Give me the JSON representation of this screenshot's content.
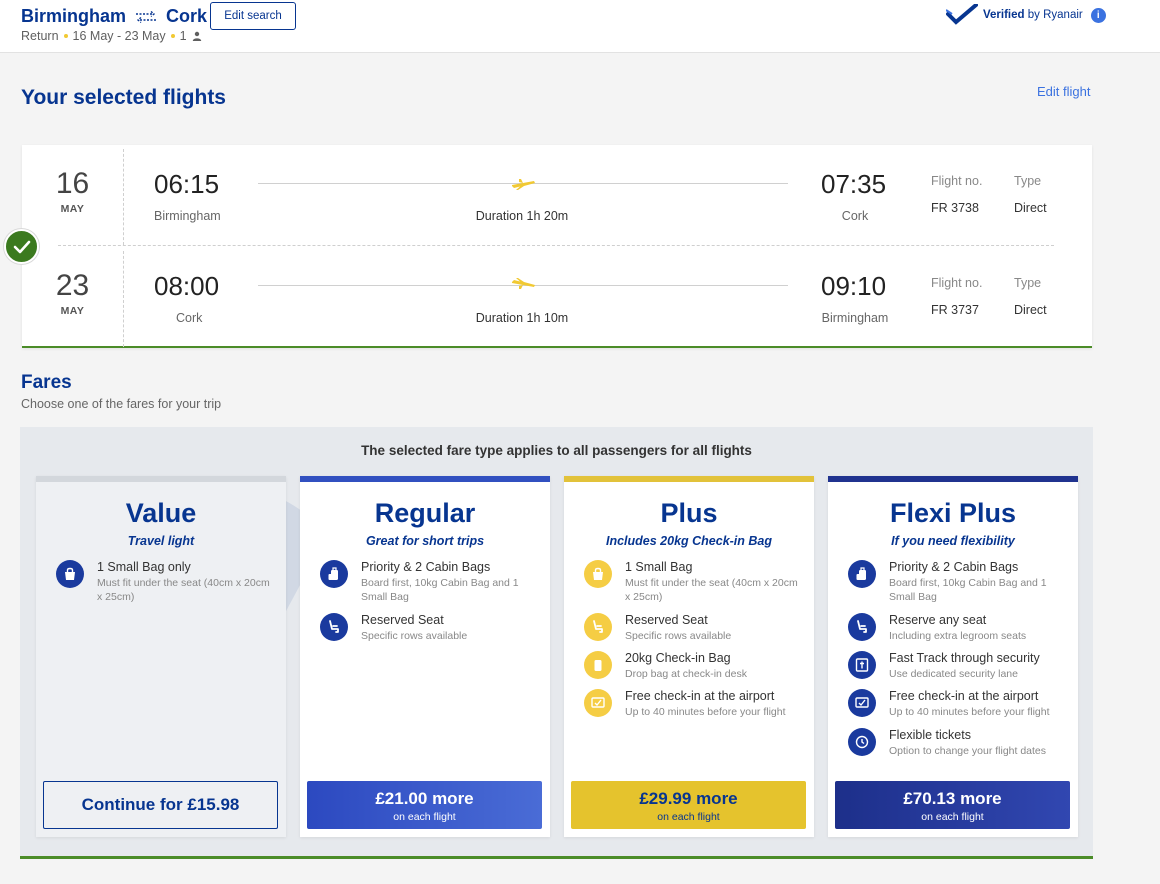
{
  "header": {
    "origin": "Birmingham",
    "destination": "Cork",
    "trip_type": "Return",
    "dates": "16 May - 23 May",
    "passengers": "1",
    "edit_search_label": "Edit search",
    "verified_bold": "Verified",
    "verified_rest": "by Ryanair"
  },
  "selected": {
    "title": "Your selected flights",
    "edit_label": "Edit flight"
  },
  "flights": [
    {
      "day": "16",
      "month": "MAY",
      "dep_time": "06:15",
      "dep_city": "Birmingham",
      "arr_time": "07:35",
      "arr_city": "Cork",
      "duration": "Duration 1h 20m",
      "flight_no_label": "Flight no.",
      "flight_no": "FR 3738",
      "type_label": "Type",
      "type": "Direct"
    },
    {
      "day": "23",
      "month": "MAY",
      "dep_time": "08:00",
      "dep_city": "Cork",
      "arr_time": "09:10",
      "arr_city": "Birmingham",
      "duration": "Duration 1h 10m",
      "flight_no_label": "Flight no.",
      "flight_no": "FR 3737",
      "type_label": "Type",
      "type": "Direct"
    }
  ],
  "fares": {
    "title": "Fares",
    "subtitle": "Choose one of the fares for your trip",
    "note": "The selected fare type applies to all passengers for all flights",
    "cards": [
      {
        "name": "Value",
        "tag": "Travel light",
        "features": [
          {
            "title": "1 Small Bag only",
            "desc": "Must fit under the seat (40cm x 20cm x 25cm)"
          }
        ],
        "button": {
          "label": "Continue for £15.98"
        }
      },
      {
        "name": "Regular",
        "tag": "Great for short trips",
        "features": [
          {
            "title": "Priority & 2 Cabin Bags",
            "desc": "Board first, 10kg Cabin Bag and 1 Small Bag"
          },
          {
            "title": "Reserved Seat",
            "desc": "Specific rows available"
          }
        ],
        "button": {
          "price": "£21.00 more",
          "each": "on each flight"
        }
      },
      {
        "name": "Plus",
        "tag": "Includes 20kg Check-in Bag",
        "features": [
          {
            "title": "1 Small Bag",
            "desc": "Must fit under the seat (40cm x 20cm x 25cm)"
          },
          {
            "title": "Reserved Seat",
            "desc": "Specific rows available"
          },
          {
            "title": "20kg Check-in Bag",
            "desc": "Drop bag at check-in desk"
          },
          {
            "title": "Free check-in at the airport",
            "desc": "Up to 40 minutes before your flight"
          }
        ],
        "button": {
          "price": "£29.99 more",
          "each": "on each flight"
        }
      },
      {
        "name": "Flexi Plus",
        "tag": "If you need flexibility",
        "features": [
          {
            "title": "Priority & 2 Cabin Bags",
            "desc": "Board first, 10kg Cabin Bag and 1 Small Bag"
          },
          {
            "title": "Reserve any seat",
            "desc": "Including extra legroom seats"
          },
          {
            "title": "Fast Track through security",
            "desc": "Use dedicated security lane"
          },
          {
            "title": "Free check-in at the airport",
            "desc": "Up to 40 minutes before your flight"
          },
          {
            "title": "Flexible tickets",
            "desc": "Option to change your flight dates"
          }
        ],
        "button": {
          "price": "£70.13 more",
          "each": "on each flight"
        }
      }
    ]
  },
  "colors": {
    "brand_navy": "#073590",
    "accent_blue": "#3b72e0",
    "gold": "#f1c933",
    "success_green": "#4b8c28"
  }
}
